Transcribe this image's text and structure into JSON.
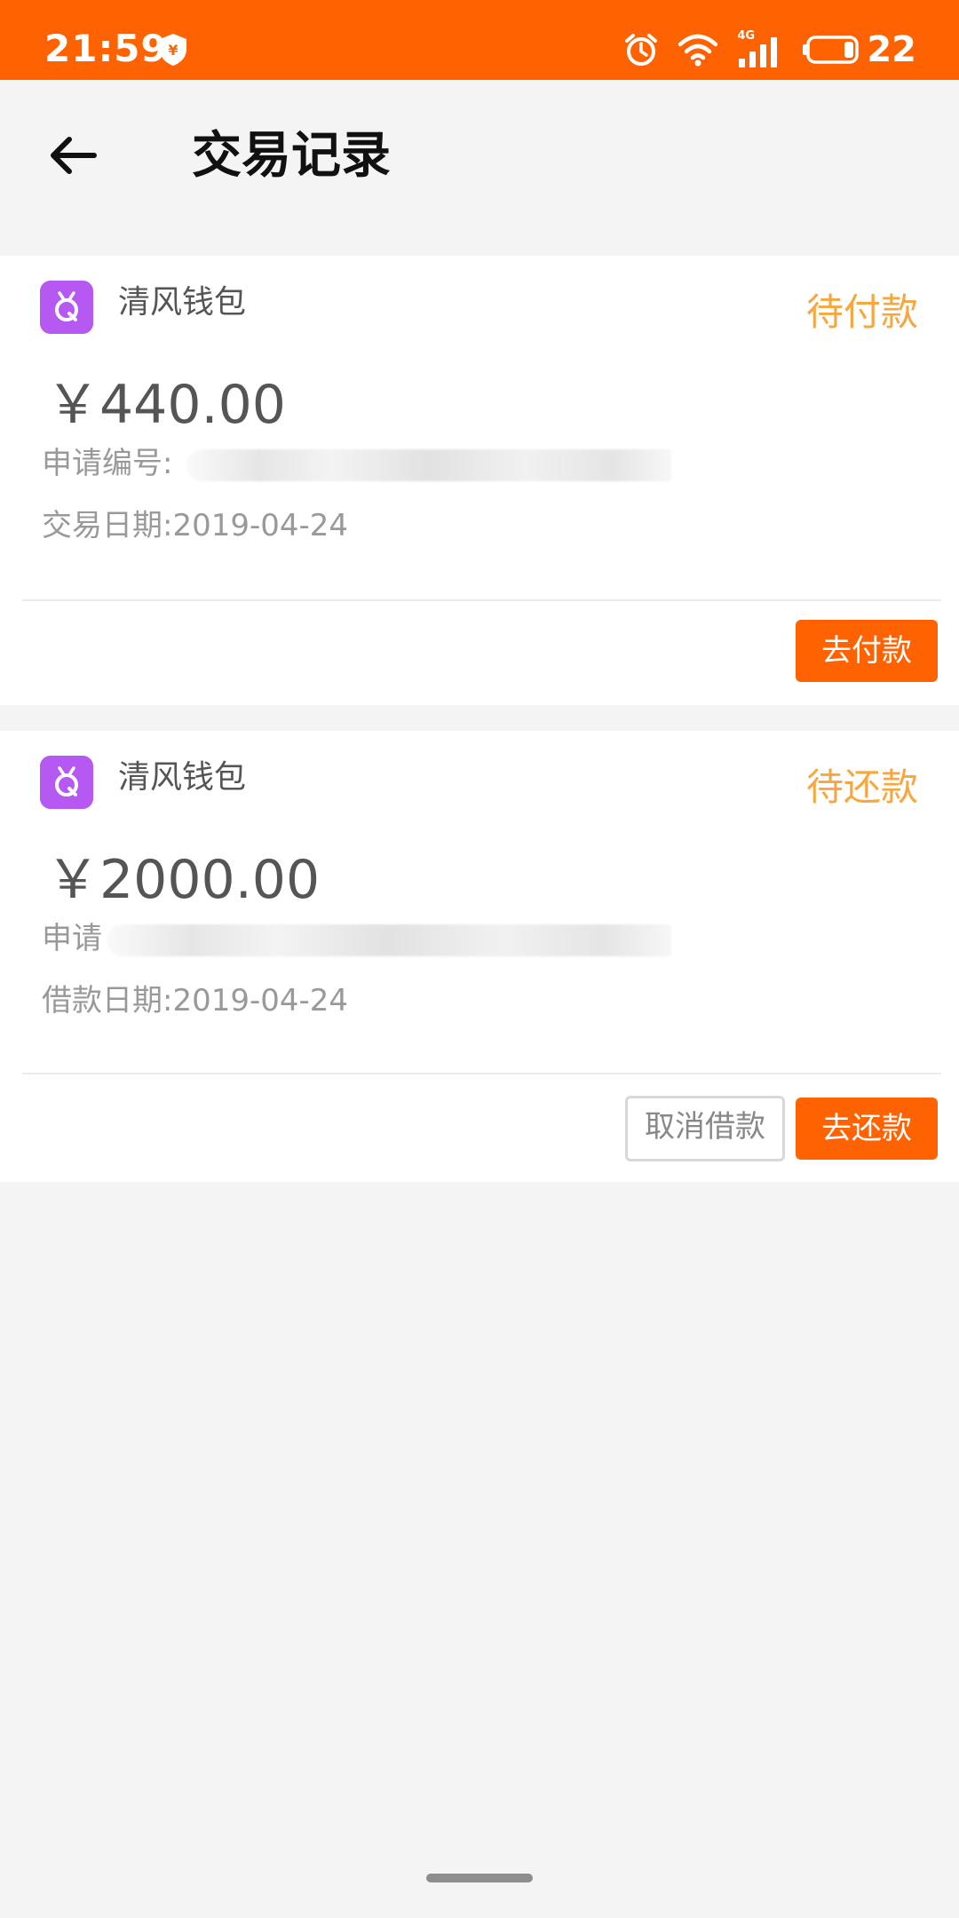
{
  "status_bar": {
    "time": "21:59",
    "network": "4G",
    "battery": "22",
    "background_color": "#ff6200",
    "icons": [
      "shield-yuan-icon",
      "alarm-icon",
      "wifi-icon",
      "signal-icon",
      "battery-icon"
    ]
  },
  "header": {
    "title": "交易记录",
    "back_icon": "back-arrow-icon"
  },
  "records": [
    {
      "app_name": "清风钱包",
      "status": "待付款",
      "amount": "￥440.00",
      "application_label": "申请编号:",
      "date_label": "交易日期:",
      "date": "2019-04-24",
      "primary_button": "去付款"
    },
    {
      "app_name": "清风钱包",
      "status": "待还款",
      "amount": "￥2000.00",
      "application_label": "申请",
      "date_label": "借款日期:",
      "date": "2019-04-24",
      "secondary_button": "取消借款",
      "primary_button": "去还款"
    }
  ],
  "colors": {
    "accent": "#ff6200",
    "status_text": "#f7a640",
    "logo": "#b659f2"
  }
}
